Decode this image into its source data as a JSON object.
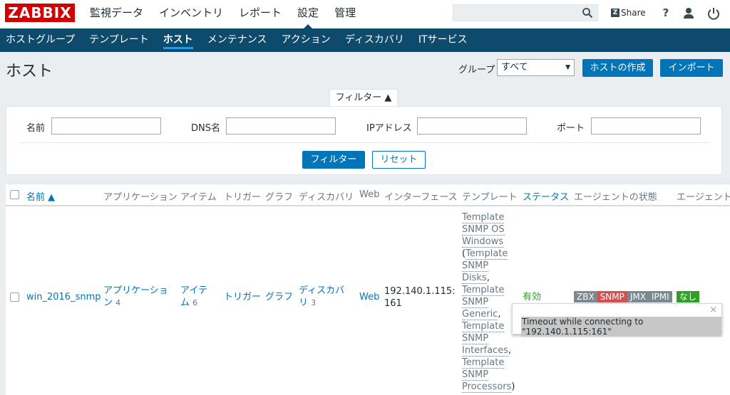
{
  "logo": "ZABBIX",
  "main_nav": [
    "監視データ",
    "インベントリ",
    "レポート",
    "設定",
    "管理"
  ],
  "main_nav_active": "設定",
  "search": {
    "placeholder": "",
    "value": ""
  },
  "share_label": "Share",
  "help_label": "?",
  "sub_nav": [
    "ホストグループ",
    "テンプレート",
    "ホスト",
    "メンテナンス",
    "アクション",
    "ディスカバリ",
    "ITサービス"
  ],
  "sub_nav_active": "ホスト",
  "page_title": "ホスト",
  "group_filter": {
    "label": "グループ",
    "selected": "すべて"
  },
  "buttons": {
    "create_host": "ホストの作成",
    "import": "インポート",
    "filter": "フィルター",
    "reset": "リセット"
  },
  "filter": {
    "tab_label": "フィルター ▲",
    "fields": {
      "name": "名前",
      "dns": "DNS名",
      "ip": "IPアドレス",
      "port": "ポート"
    }
  },
  "table": {
    "headers": [
      "名前 ▲",
      "アプリケーション",
      "アイテム",
      "トリガー",
      "グラフ",
      "ディスカバリ",
      "Web",
      "インターフェース",
      "テンプレート",
      "ステータス",
      "エージェントの状態",
      "エージェント"
    ],
    "row": {
      "name": "win_2016_snmp",
      "applications_label": "アプリケーション",
      "applications_count": "4",
      "items_label": "アイテム",
      "items_count": "6",
      "triggers_label": "トリガー",
      "graphs_label": "グラフ",
      "discovery_label": "ディスカバリ",
      "discovery_count": "3",
      "web_label": "Web",
      "interface": "192.140.1.115: 161",
      "templates": [
        "Template SNMP OS Windows",
        "Template SNMP Disks",
        "Template SNMP Generic",
        "Template SNMP Interfaces",
        "Template SNMP Processors"
      ],
      "status": "有効",
      "availability": [
        "ZBX",
        "SNMP",
        "JMX",
        "IPMI"
      ],
      "encryption": "なし"
    }
  },
  "tooltip": {
    "message": "Timeout while connecting to \"192.140.1.115:161\"",
    "close": "×"
  },
  "colors": {
    "logo_red": "#d40000",
    "nav_blue": "#0e4a6b",
    "button_blue": "#0275b8",
    "status_green": "#2f9f26",
    "snmp_error_red": "#d64e4e"
  }
}
